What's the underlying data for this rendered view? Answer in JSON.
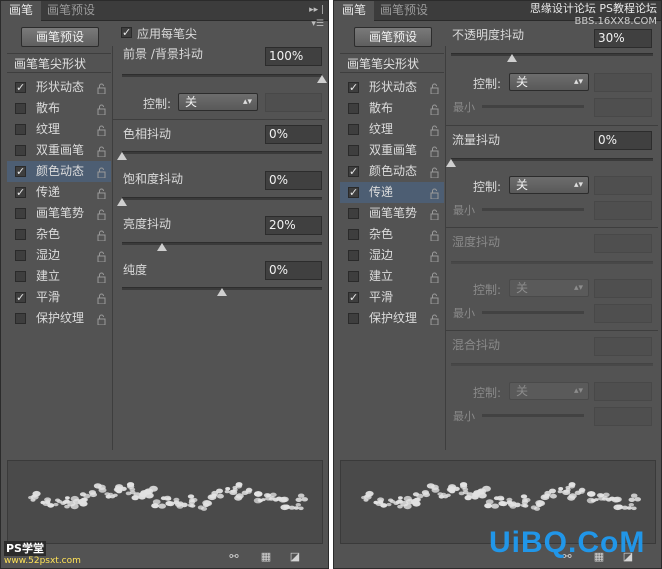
{
  "left_panel": {
    "tabs": [
      "画笔",
      "画笔预设"
    ],
    "tab_menu": "▸▸ | ▾☰",
    "preset_button": "画笔预设",
    "options_header": "画笔笔尖形状",
    "options": [
      {
        "label": "形状动态",
        "checked": true
      },
      {
        "label": "散布",
        "checked": false
      },
      {
        "label": "纹理",
        "checked": false
      },
      {
        "label": "双重画笔",
        "checked": false
      },
      {
        "label": "颜色动态",
        "checked": true,
        "selected": true
      },
      {
        "label": "传递",
        "checked": true
      },
      {
        "label": "画笔笔势",
        "checked": false
      },
      {
        "label": "杂色",
        "checked": false
      },
      {
        "label": "湿边",
        "checked": false
      },
      {
        "label": "建立",
        "checked": false
      },
      {
        "label": "平滑",
        "checked": true
      },
      {
        "label": "保护纹理",
        "checked": false
      }
    ],
    "apply_per_tip": "应用每笔尖",
    "fg_bg_jitter": {
      "label": "前景 /背景抖动",
      "value": "100%",
      "level": 1.0
    },
    "control_label": "控制:",
    "control_value": "关",
    "hue_jitter": {
      "label": "色相抖动",
      "value": "0%",
      "level": 0.0
    },
    "saturation_jitter": {
      "label": "饱和度抖动",
      "value": "0%",
      "level": 0.0
    },
    "brightness_jitter": {
      "label": "亮度抖动",
      "value": "20%",
      "level": 0.2
    },
    "purity": {
      "label": "纯度",
      "value": "0%",
      "level": 0.5
    }
  },
  "right_panel": {
    "tabs": [
      "画笔",
      "画笔预设"
    ],
    "watermark": "思缘设计论坛",
    "watermark2": "PS教程论坛",
    "watermark_sub": "BBS.16XX8.COM",
    "preset_button": "画笔预设",
    "options_header": "画笔笔尖形状",
    "options": [
      {
        "label": "形状动态",
        "checked": true
      },
      {
        "label": "散布",
        "checked": false
      },
      {
        "label": "纹理",
        "checked": false
      },
      {
        "label": "双重画笔",
        "checked": false
      },
      {
        "label": "颜色动态",
        "checked": true
      },
      {
        "label": "传递",
        "checked": true,
        "selected": true
      },
      {
        "label": "画笔笔势",
        "checked": false
      },
      {
        "label": "杂色",
        "checked": false
      },
      {
        "label": "湿边",
        "checked": false
      },
      {
        "label": "建立",
        "checked": false
      },
      {
        "label": "平滑",
        "checked": true
      },
      {
        "label": "保护纹理",
        "checked": false
      }
    ],
    "opacity_jitter": {
      "label": "不透明度抖动",
      "value": "30%",
      "level": 0.3
    },
    "flow_jitter": {
      "label": "流量抖动",
      "value": "0%",
      "level": 0.0
    },
    "wetness_jitter": {
      "label": "湿度抖动"
    },
    "mix_jitter": {
      "label": "混合抖动"
    },
    "control_label": "控制:",
    "control_value": "关",
    "min_label": "最小"
  },
  "branding": {
    "left_ps": "PS学堂",
    "left_url": "www.52psxt.com",
    "right_logo": "UiBQ.CoM"
  },
  "colors": {
    "panel_bg": "#535353",
    "tab_bar": "#3c3c3c",
    "selected_row": "#4d5e73",
    "logo_blue": "#2196e8"
  }
}
